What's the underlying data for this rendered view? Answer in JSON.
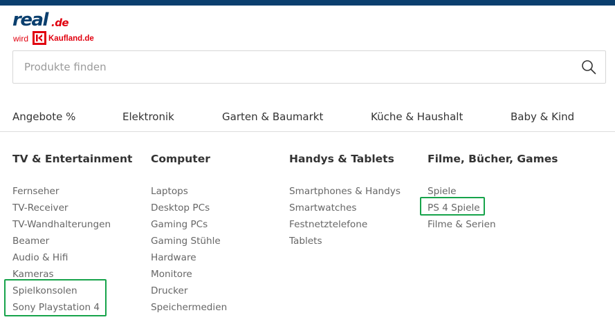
{
  "brand": {
    "logo_real": "real",
    "logo_de": ".de",
    "logo_wird": "wird",
    "logo_kaufland": "Kaufland.de",
    "primary_color": "#0a3f6e",
    "accent_color": "#e1000f"
  },
  "search": {
    "placeholder": "Produkte finden",
    "value": "",
    "icon": "search-icon"
  },
  "nav": [
    {
      "label": "Angebote %"
    },
    {
      "label": "Elektronik"
    },
    {
      "label": "Garten & Baumarkt"
    },
    {
      "label": "Küche & Haushalt"
    },
    {
      "label": "Baby & Kind"
    }
  ],
  "columns": [
    {
      "title": "TV & Entertainment",
      "items": [
        "Fernseher",
        "TV-Receiver",
        "TV-Wandhalterungen",
        "Beamer",
        "Audio & Hifi",
        "Kameras",
        "Spielkonsolen",
        "Sony Playstation 4"
      ]
    },
    {
      "title": "Computer",
      "items": [
        "Laptops",
        "Desktop PCs",
        "Gaming PCs",
        "Gaming Stühle",
        "Hardware",
        "Monitore",
        "Drucker",
        "Speichermedien"
      ]
    },
    {
      "title": "Handys & Tablets",
      "items": [
        "Smartphones & Handys",
        "Smartwatches",
        "Festnetztelefone",
        "Tablets"
      ]
    },
    {
      "title": "Filme, Bücher, Games",
      "items": [
        "Spiele",
        "PS 4 Spiele",
        "Filme & Serien"
      ]
    }
  ],
  "highlight_color": "#16a34a"
}
